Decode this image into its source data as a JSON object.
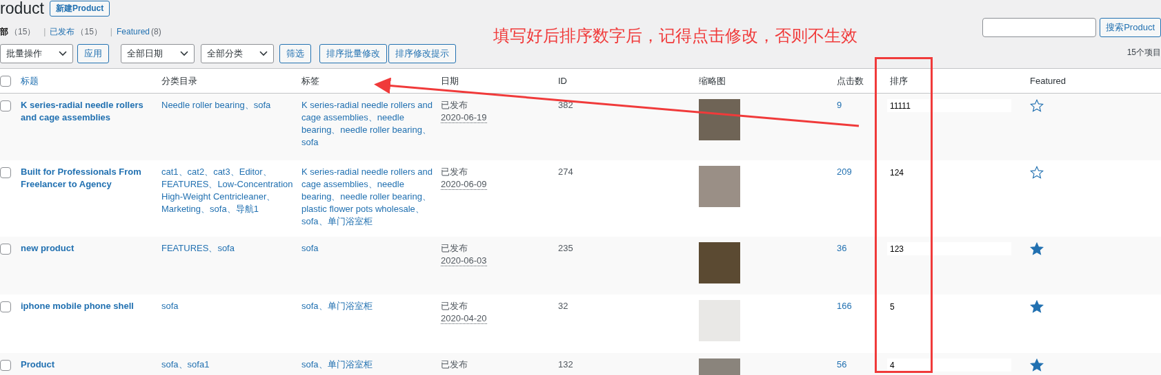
{
  "page_title": "roduct",
  "add_button": "新建Product",
  "views": [
    {
      "label": "部",
      "count": "（15）",
      "selected": true
    },
    {
      "separator": "|",
      "label": "已发布",
      "count": "（15）",
      "selected": false
    },
    {
      "separator": "|",
      "label": "Featured",
      "count": "(8)",
      "selected": false
    }
  ],
  "toolbar": [
    {
      "kind": "select",
      "label": "批量操作"
    },
    {
      "kind": "button",
      "label": "应用"
    },
    {
      "kind": "select",
      "label": "全部日期"
    },
    {
      "kind": "select",
      "label": "全部分类"
    },
    {
      "kind": "button",
      "label": "筛选"
    },
    {
      "kind": "button",
      "label": "排序批量修改"
    },
    {
      "kind": "button",
      "label": "排序修改提示"
    }
  ],
  "search": {
    "button": "搜索Product"
  },
  "item_count": "15个项目",
  "table": {
    "columns": [
      "标题",
      "分类目录",
      "标签",
      "日期",
      "ID",
      "缩略图",
      "点击数",
      "排序",
      "Featured"
    ],
    "select_all_checked": false,
    "rows": [
      {
        "title": "K series-radial needle rollers and cage assemblies",
        "categories": "Needle roller bearing、sofa",
        "tags": "K series-radial needle rollers and cage assemblies、needle bearing、needle roller bearing、sofa",
        "status": "已发布",
        "date": "2020-06-19",
        "id": "382",
        "clicks": "9",
        "sort": "11111",
        "featured": false,
        "checked": false
      },
      {
        "title": "Built for Professionals From Freelancer to Agency",
        "categories": "cat1、cat2、cat3、Editor、FEATURES、Low-Concentration High-Weight Centricleaner、Marketing、sofa、导航1",
        "tags": "K series-radial needle rollers and cage assemblies、needle bearing、needle roller bearing、plastic flower pots wholesale、sofa、单门浴室柜",
        "status": "已发布",
        "date": "2020-06-09",
        "id": "274",
        "clicks": "209",
        "sort": "124",
        "featured": false,
        "checked": false
      },
      {
        "title": "new product",
        "categories": "FEATURES、sofa",
        "tags": "sofa",
        "status": "已发布",
        "date": "2020-06-03",
        "id": "235",
        "clicks": "36",
        "sort": "123",
        "featured": true,
        "checked": false
      },
      {
        "title": "iphone mobile phone shell",
        "categories": "sofa",
        "tags": "sofa、单门浴室柜",
        "status": "已发布",
        "date": "2020-04-20",
        "id": "32",
        "clicks": "166",
        "sort": "5",
        "featured": true,
        "checked": false
      },
      {
        "title": "Product",
        "categories": "sofa、sofa1",
        "tags": "sofa、单门浴室柜",
        "status": "已发布",
        "date": "",
        "id": "132",
        "clicks": "56",
        "sort": "4",
        "featured": true,
        "checked": false
      }
    ]
  },
  "annotation": {
    "text": "填写好后排序数字后，记得点击修改，否则不生效"
  }
}
